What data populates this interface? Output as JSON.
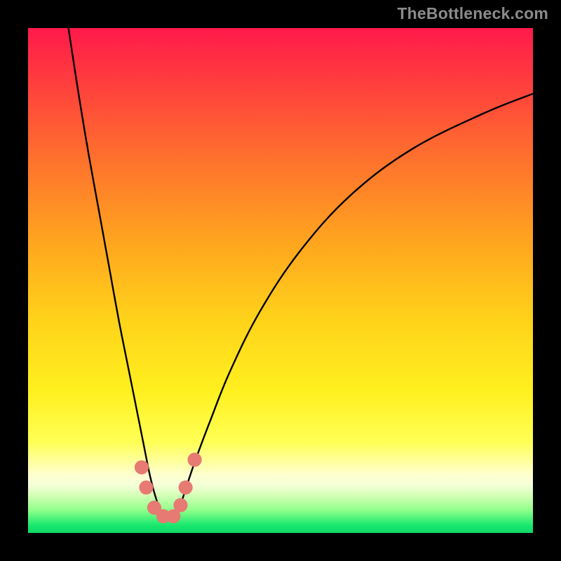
{
  "watermark": {
    "text": "TheBottleneck.com"
  },
  "chart_data": {
    "type": "line",
    "title": "",
    "xlabel": "",
    "ylabel": "",
    "xlim": [
      0,
      100
    ],
    "ylim": [
      0,
      100
    ],
    "grid": false,
    "legend": false,
    "background_gradient_stops": [
      {
        "offset": 0.0,
        "color": "#ff1a4b"
      },
      {
        "offset": 0.1,
        "color": "#ff3b3e"
      },
      {
        "offset": 0.25,
        "color": "#ff6e2e"
      },
      {
        "offset": 0.42,
        "color": "#ffa41f"
      },
      {
        "offset": 0.58,
        "color": "#ffd31a"
      },
      {
        "offset": 0.72,
        "color": "#fff01f"
      },
      {
        "offset": 0.82,
        "color": "#ffff55"
      },
      {
        "offset": 0.885,
        "color": "#ffffd0"
      },
      {
        "offset": 0.905,
        "color": "#f4ffd8"
      },
      {
        "offset": 0.925,
        "color": "#d6ffb8"
      },
      {
        "offset": 0.955,
        "color": "#8fff8a"
      },
      {
        "offset": 0.985,
        "color": "#17e86e"
      },
      {
        "offset": 1.0,
        "color": "#0fd867"
      }
    ],
    "series": [
      {
        "name": "bottleneck-curve",
        "color": "#000000",
        "x": [
          8,
          10,
          12,
          14,
          16,
          18,
          20,
          21,
          22,
          23,
          24,
          25,
          26,
          27,
          28,
          29,
          30,
          31,
          33,
          36,
          40,
          46,
          54,
          64,
          76,
          90,
          100
        ],
        "y": [
          100,
          87,
          75,
          64,
          53,
          42,
          32,
          27,
          22,
          17,
          12,
          8,
          5,
          3,
          2.5,
          3,
          5,
          8,
          14,
          22,
          32,
          44,
          56,
          67,
          76,
          83,
          87
        ]
      }
    ],
    "markers": {
      "name": "highlight-cluster",
      "color": "#e77a72",
      "radius_pct": 1.4,
      "points": [
        {
          "x": 22.5,
          "y": 13
        },
        {
          "x": 23.4,
          "y": 9
        },
        {
          "x": 25.0,
          "y": 5
        },
        {
          "x": 26.8,
          "y": 3.3
        },
        {
          "x": 28.8,
          "y": 3.3
        },
        {
          "x": 30.2,
          "y": 5.5
        },
        {
          "x": 31.2,
          "y": 9
        },
        {
          "x": 33.0,
          "y": 14.5
        }
      ]
    }
  }
}
